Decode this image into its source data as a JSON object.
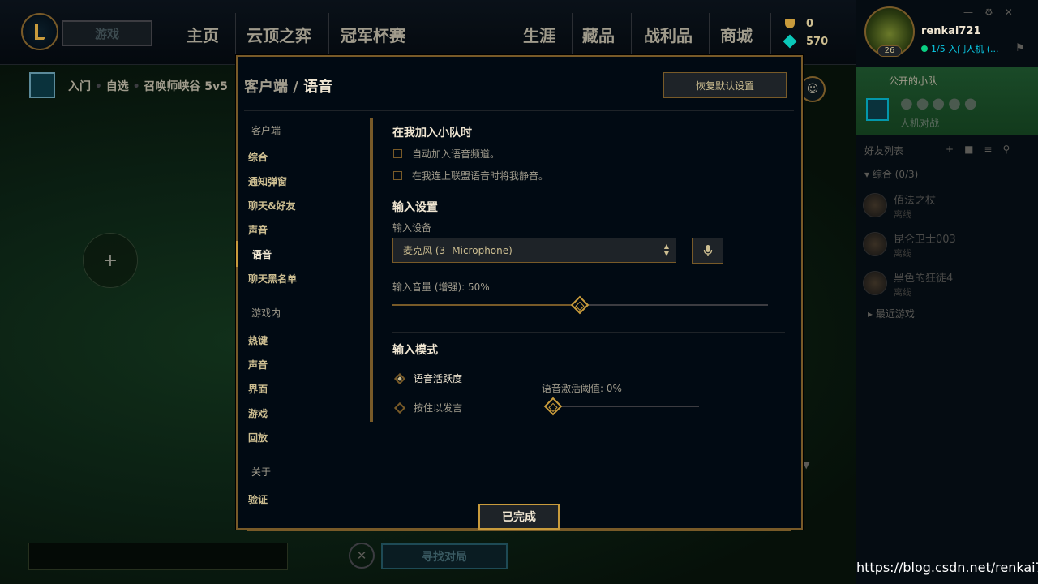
{
  "topbar": {
    "play_label": "游戏",
    "nav": [
      "主页",
      "云顶之弈",
      "冠军杯赛",
      "生涯",
      "藏品",
      "战利品",
      "商城"
    ],
    "currency": {
      "be": "0",
      "rp": "570"
    }
  },
  "user": {
    "name": "renkai721",
    "level": "26",
    "status": "1/5 入门人机 (..."
  },
  "party": {
    "title": "公开的小队",
    "mode": "人机对战"
  },
  "friends": {
    "title": "好友列表",
    "group": "综合 (0/3)",
    "list": [
      {
        "name": "佰法之杖",
        "status": "离线"
      },
      {
        "name": "昆仑卫士003",
        "status": "离线"
      },
      {
        "name": "黑色的狂徒4",
        "status": "离线"
      }
    ],
    "recent": "最近游戏"
  },
  "lobby": {
    "breadcrumb": [
      "入门",
      "自选",
      "召唤师峡谷 5v5"
    ],
    "find_match": "寻找对局"
  },
  "watermark": "https://blog.csdn.net/renkai721",
  "modal": {
    "title_section": "客户端",
    "title_sep": "/",
    "title_current": "语音",
    "reset_label": "恢复默认设置",
    "done_label": "已完成",
    "sidebar": {
      "client_header": "客户端",
      "client_items": [
        "综合",
        "通知弹窗",
        "聊天&好友",
        "声音",
        "语音",
        "聊天黑名单"
      ],
      "ingame_header": "游戏内",
      "ingame_items": [
        "热键",
        "声音",
        "界面",
        "游戏",
        "回放"
      ],
      "about_header": "关于",
      "about_items": [
        "验证"
      ]
    },
    "party_join": {
      "heading": "在我加入小队时",
      "auto_join": "自动加入语音频道。",
      "mute_on_connect": "在我连上联盟语音时将我静音。"
    },
    "input": {
      "heading": "输入设置",
      "device_label": "输入设备",
      "device_value": "麦克风 (3- Microphone)",
      "volume_label": "输入音量 (增强): 50%",
      "volume_value": 0.5
    },
    "mode": {
      "heading": "输入模式",
      "option_activity": "语音活跃度",
      "option_ptt": "按住以发言",
      "selected": "语音活跃度",
      "threshold_label": "语音激活阈值: 0%",
      "threshold_value": 0
    }
  }
}
